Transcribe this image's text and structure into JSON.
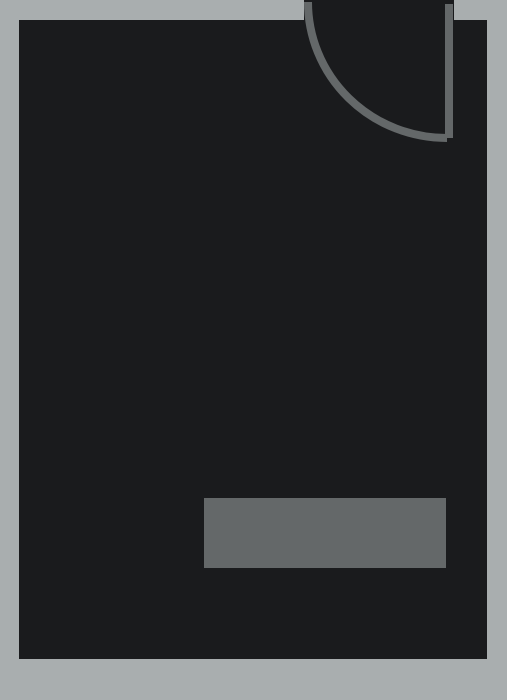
{
  "colors": {
    "frame": "#a9aeaf",
    "floor": "#1a1b1d",
    "door": "#646869",
    "fixture": "#646869"
  },
  "elements": {
    "wall_frame": "outer-wall",
    "room": "room-floor",
    "door": "door-swing-arc",
    "fixture": "rectangular-fixture"
  }
}
